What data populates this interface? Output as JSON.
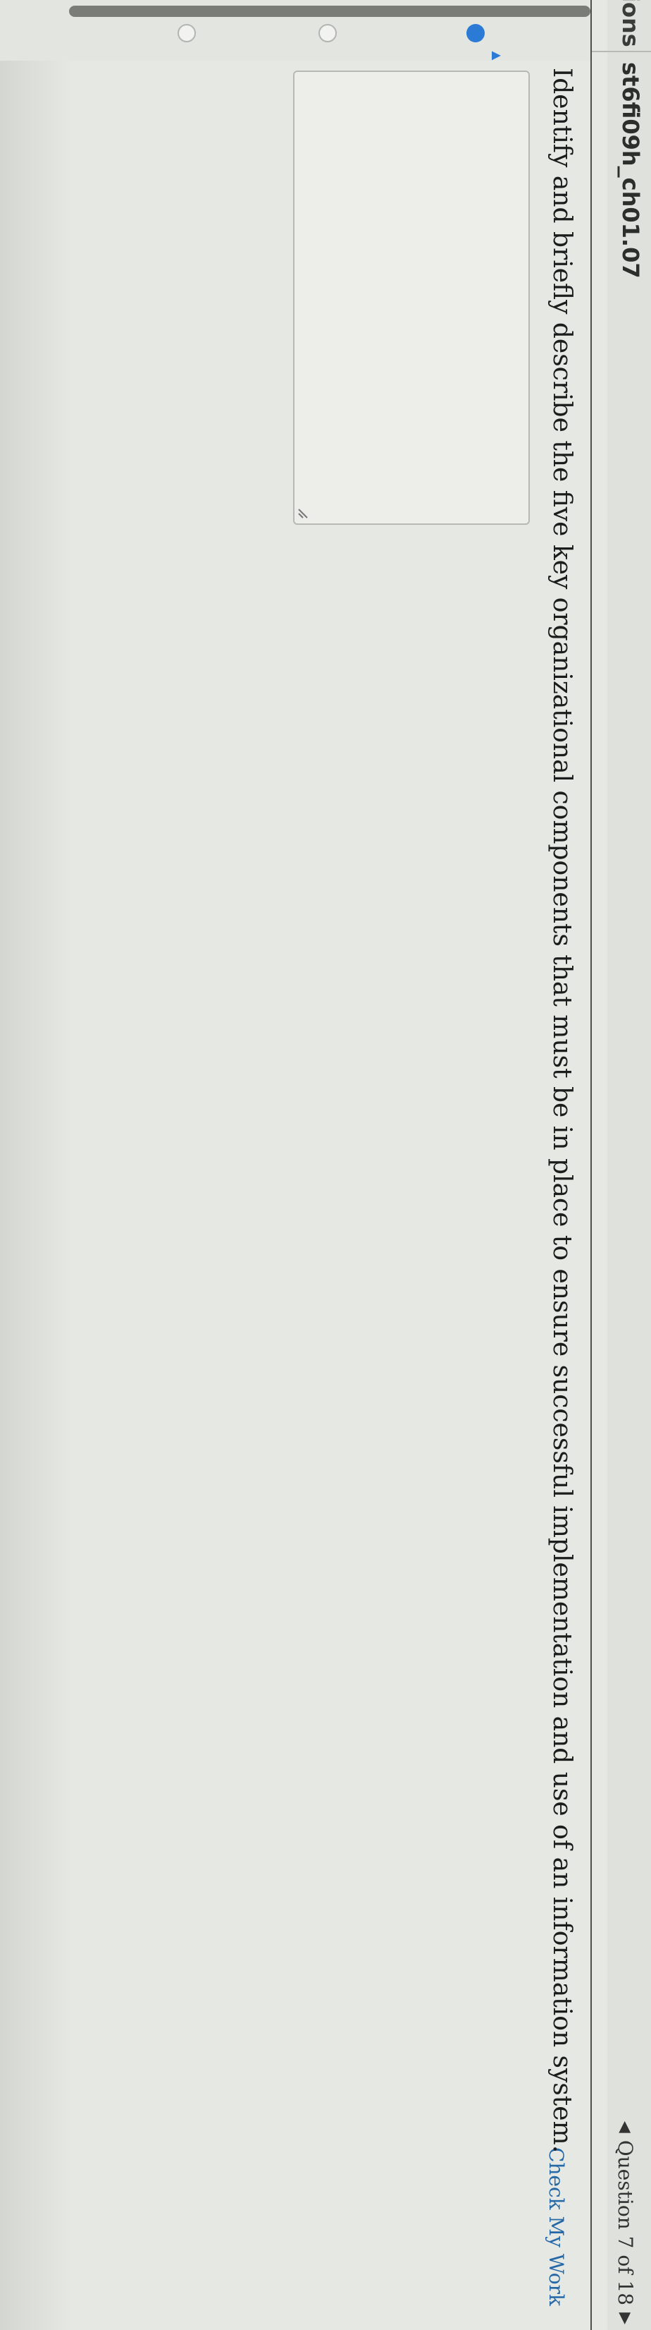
{
  "header": {
    "cut_label": "ions",
    "assignment_title": "st6fi09h_ch01.07"
  },
  "navigator": {
    "prev_icon": "triangle-left",
    "label": "Question 7 of 18",
    "next_icon": "triangle-right"
  },
  "actions": {
    "check_my_work": "Check My Work"
  },
  "question": {
    "text": "Identify and briefly describe the five key organizational components that must be in place to ensure successful implementation and use of an information system."
  },
  "answer": {
    "value": ""
  },
  "colors": {
    "accent": "#2b7bd6",
    "link": "#2468a8"
  }
}
